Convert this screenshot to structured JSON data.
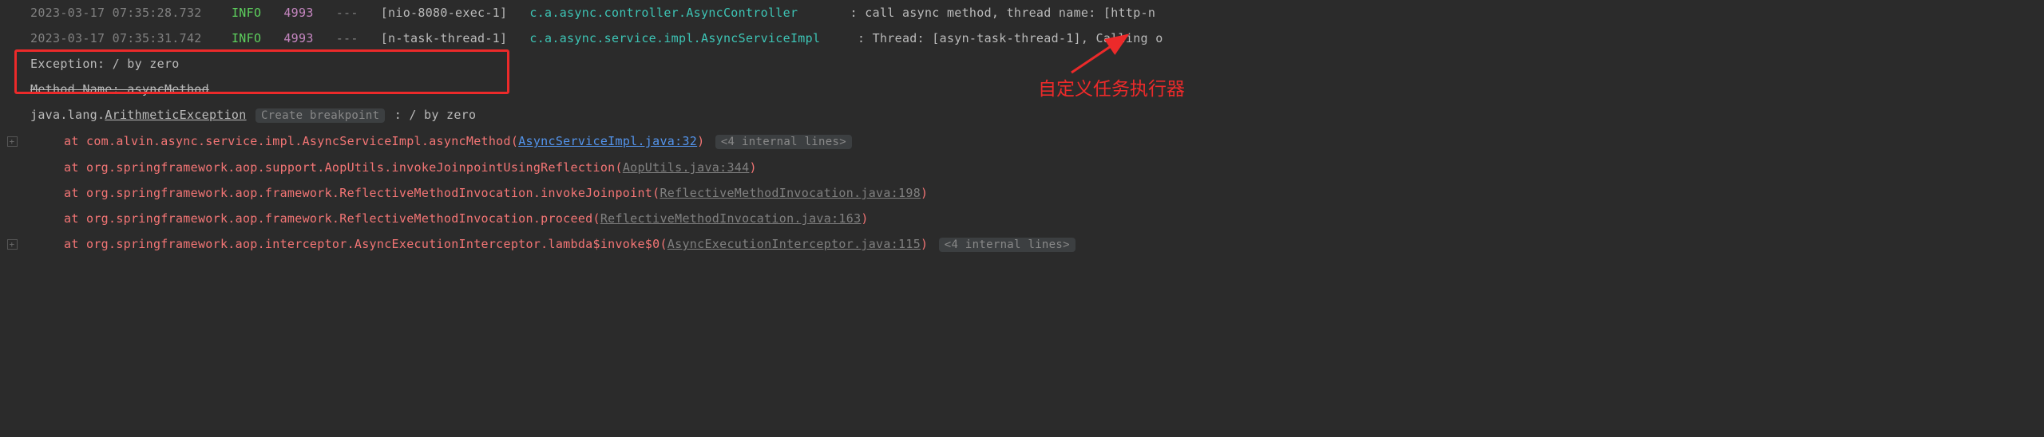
{
  "logs": [
    {
      "ts": "2023-03-17 07:35:28.732",
      "level": "INFO",
      "pid": "4993",
      "dash": "---",
      "thread": "[nio-8080-exec-1]",
      "logger": "c.a.async.controller.AsyncController",
      "msg": ": call async method, thread name: [http-n"
    },
    {
      "ts": "2023-03-17 07:35:31.742",
      "level": "INFO",
      "pid": "4993",
      "dash": "---",
      "thread": "[n-task-thread-1]",
      "logger": "c.a.async.service.impl.AsyncServiceImpl",
      "msg": ": Thread: [asyn-task-thread-1], Calling o"
    }
  ],
  "exception_text": "Exception: / by zero",
  "method_line": "Method Name: asyncMethod",
  "exception": {
    "cls_prefix": "java.lang.",
    "cls_link": "ArithmeticException",
    "breakpoint": "Create breakpoint",
    "msg": ": / by zero"
  },
  "frames": [
    {
      "at": "at com.alvin.async.service.impl.AsyncServiceImpl.asyncMethod(",
      "link": "AsyncServiceImpl.java:32",
      "link_type": "blue",
      "close": ")",
      "internal": "<4 internal lines>"
    },
    {
      "at": "at org.springframework.aop.support.AopUtils.invokeJoinpointUsingReflection(",
      "link": "AopUtils.java:344",
      "link_type": "gray",
      "close": ")"
    },
    {
      "at": "at org.springframework.aop.framework.ReflectiveMethodInvocation.invokeJoinpoint(",
      "link": "ReflectiveMethodInvocation.java:198",
      "link_type": "gray",
      "close": ")"
    },
    {
      "at": "at org.springframework.aop.framework.ReflectiveMethodInvocation.proceed(",
      "link": "ReflectiveMethodInvocation.java:163",
      "link_type": "gray",
      "close": ")"
    },
    {
      "at": "at org.springframework.aop.interceptor.AsyncExecutionInterceptor.lambda$invoke$0(",
      "link": "AsyncExecutionInterceptor.java:115",
      "link_type": "gray",
      "close": ")",
      "internal": "<4 internal lines>"
    }
  ],
  "annotation": "自定义任务执行器"
}
